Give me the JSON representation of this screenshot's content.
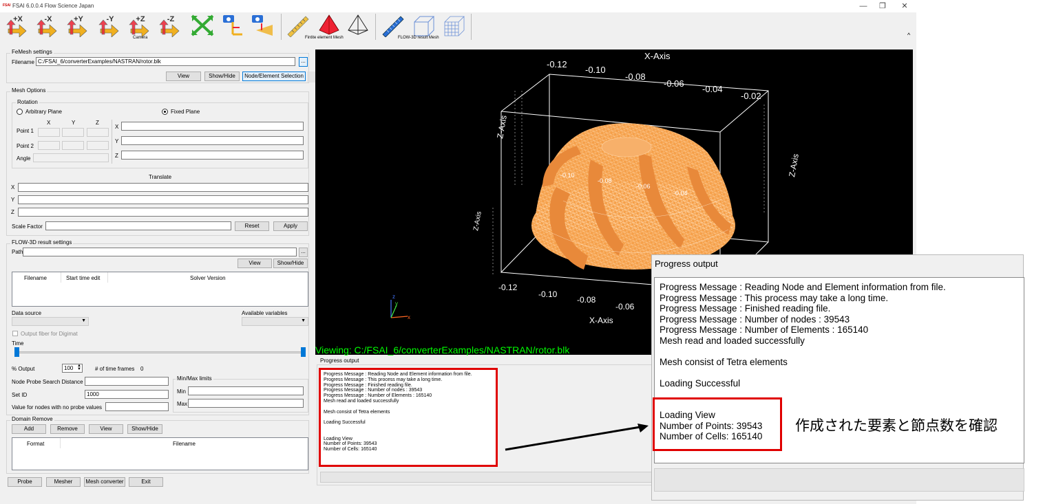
{
  "window": {
    "title": "FSAI 6.0.0.4 Flow Science Japan",
    "logo": "FSAI",
    "minimize": "—",
    "restore": "❐",
    "close": "✕"
  },
  "toolbar": {
    "buttons": [
      {
        "label": "+X",
        "icon": "axis-plus-x-icon"
      },
      {
        "label": "-X",
        "icon": "axis-minus-x-icon"
      },
      {
        "label": "+Y",
        "icon": "axis-plus-y-icon"
      },
      {
        "label": "-Y",
        "icon": "axis-minus-y-icon"
      },
      {
        "label": "+Z",
        "icon": "axis-plus-z-icon"
      },
      {
        "label": "-Z",
        "icon": "axis-minus-z-icon"
      },
      {
        "label": "",
        "icon": "fit-arrows-icon"
      },
      {
        "label": "",
        "icon": "camera-icon"
      },
      {
        "label": "",
        "icon": "camera-plane-icon"
      }
    ],
    "camera_caption": "Camera",
    "fem_caption": "Fintite element Mesh",
    "flow3d_caption": "FLOW-3D result Mesh",
    "collapse": "^"
  },
  "femesh": {
    "group_label": "FeMesh settings",
    "filename_label": "Filename",
    "filename_value": "C:/FSAI_6/converterExamples/NASTRAN/rotor.blk",
    "browse": "...",
    "view": "View",
    "showhide": "Show/Hide",
    "node_element": "Node/Element Selection"
  },
  "mesh_options": {
    "group_label": "Mesh Options",
    "rotation_label": "Rotation",
    "arbitrary_plane": "Arbitrary Plane",
    "fixed_plane": "Fixed Plane",
    "col_x": "X",
    "col_y": "Y",
    "col_z": "Z",
    "point1": "Point 1",
    "point2": "Point 2",
    "angle": "Angle",
    "fx": "X",
    "fy": "Y",
    "fz": "Z",
    "translate_label": "Translate",
    "tx": "X",
    "ty": "Y",
    "tz": "Z",
    "scale_factor": "Scale Factor",
    "reset": "Reset",
    "apply": "Apply"
  },
  "flow3d": {
    "group_label": "FLOW-3D result settings",
    "path_label": "Path",
    "browse": "...",
    "view": "View",
    "showhide": "Show/Hide",
    "columns": [
      "Filename",
      "Start time edit",
      "Solver Version"
    ],
    "data_source": "Data source",
    "available_variables": "Available variables",
    "output_fiber": "Output fiber for Digimat",
    "time_label": "Time",
    "pct_output_label": "% Output",
    "pct_output_value": "100",
    "time_frames_label": "# of time frames",
    "time_frames_value": "0",
    "node_probe_label": "Node Probe Search Distance",
    "set_id_label": "Set ID",
    "set_id_value": "1000",
    "no_probe_label": "Value for nodes with no probe values",
    "minmax_label": "Min/Max limits",
    "min_label": "Min",
    "max_label": "Max"
  },
  "domain_remove": {
    "group_label": "Domain Remove",
    "add": "Add",
    "remove": "Remove",
    "view": "View",
    "showhide": "Show/Hide",
    "columns": [
      "Format",
      "Filename"
    ]
  },
  "bottom_buttons": [
    "Probe",
    "Mesher",
    "Mesh converter",
    "Exit"
  ],
  "viewer": {
    "status": "Viewing: C:/FSAI_6/converterExamples/NASTRAN/rotor.blk",
    "x_axis_top": "X-Axis",
    "x_axis_bottom": "X-Axis",
    "z_axis_left": "Z-Axis",
    "z_axis_right": "Z-Axis",
    "z_axis_far": "Z-Axis",
    "top_ticks": [
      "-0.12",
      "-0.10",
      "-0.08",
      "-0.06",
      "-0.04",
      "-0.02"
    ],
    "bottom_ticks": [
      "-0.12",
      "-0.10",
      "-0.08",
      "-0.06"
    ],
    "inner_ticks": [
      "-0.10",
      "-0.08",
      "-0.06",
      "-0.04"
    ],
    "axis_x": "x",
    "axis_y": "y",
    "axis_z": "z",
    "mesh_color": "#f5a04a"
  },
  "progress": {
    "label": "Progress output",
    "lines": [
      "Progress Message : Reading Node and Element information from file.",
      "Progress Message : This process may take a long time.",
      "Progress Message : Finished reading file.",
      "Progress Message : Number of nodes : 39543",
      "Progress Message : Number of Elements : 165140",
      "Mesh read and loaded successfully",
      "",
      "Mesh consist of Tetra elements",
      "",
      "Loading Successful",
      "",
      "",
      "Loading View",
      "Number of Points: 39543",
      "Number of Cells: 165140"
    ]
  },
  "zoom": {
    "title": "Progress output",
    "lines": [
      "Progress Message : Reading Node and Element information from file.",
      "Progress Message : This process may take a long time.",
      "Progress Message : Finished reading file.",
      "Progress Message : Number of nodes : 39543",
      "Progress Message : Number of Elements : 165140",
      "Mesh read and loaded successfully",
      "Mesh consist of Tetra elements",
      "Loading Successful",
      "Loading View",
      "Number of Points: 39543",
      "Number of Cells: 165140"
    ]
  },
  "annotation": "作成された要素と節点数を確認",
  "colors": {
    "highlight": "#e00000",
    "viewer_bg": "#000000",
    "status_green": "#00ff00"
  }
}
